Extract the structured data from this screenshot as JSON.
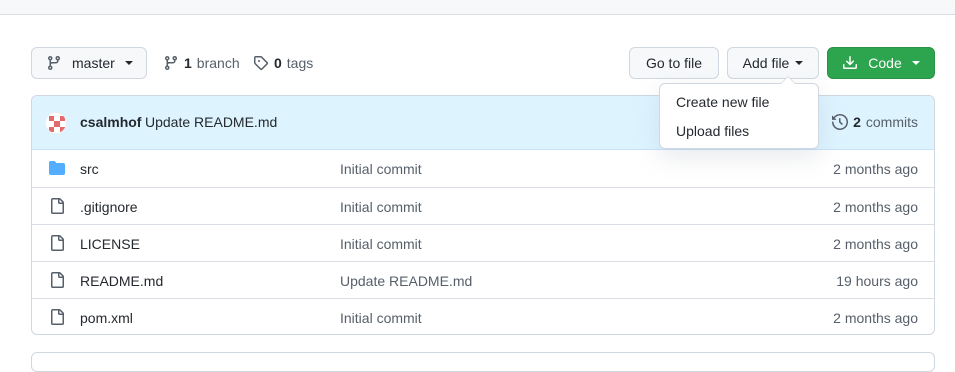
{
  "branch_selector": {
    "label": "master"
  },
  "repo_meta": {
    "branch_count": "1",
    "branch_label": "branch",
    "tag_count": "0",
    "tag_label": "tags"
  },
  "actions": {
    "goto_file": "Go to file",
    "add_file": "Add file",
    "code": "Code"
  },
  "add_file_menu": {
    "items": [
      "Create new file",
      "Upload files"
    ]
  },
  "latest_commit": {
    "author": "csalmhof",
    "message": "Update README.md",
    "commit_count": "2",
    "commit_label": "commits"
  },
  "files": [
    {
      "name": "src",
      "type": "folder",
      "commit": "Initial commit",
      "age": "2 months ago"
    },
    {
      "name": ".gitignore",
      "type": "file",
      "commit": "Initial commit",
      "age": "2 months ago"
    },
    {
      "name": "LICENSE",
      "type": "file",
      "commit": "Initial commit",
      "age": "2 months ago"
    },
    {
      "name": "README.md",
      "type": "file",
      "commit": "Update README.md",
      "age": "19 hours ago"
    },
    {
      "name": "pom.xml",
      "type": "file",
      "commit": "Initial commit",
      "age": "2 months ago"
    }
  ],
  "colors": {
    "primary_green": "#2da44e",
    "folder_blue": "#54aeff",
    "commit_header_bg": "#ddf4ff",
    "muted_text": "#57606a"
  },
  "icons": {
    "branch": "git-branch-icon",
    "tag": "tag-icon",
    "download": "download-icon",
    "history": "history-icon",
    "folder": "folder-icon",
    "file": "file-icon"
  }
}
